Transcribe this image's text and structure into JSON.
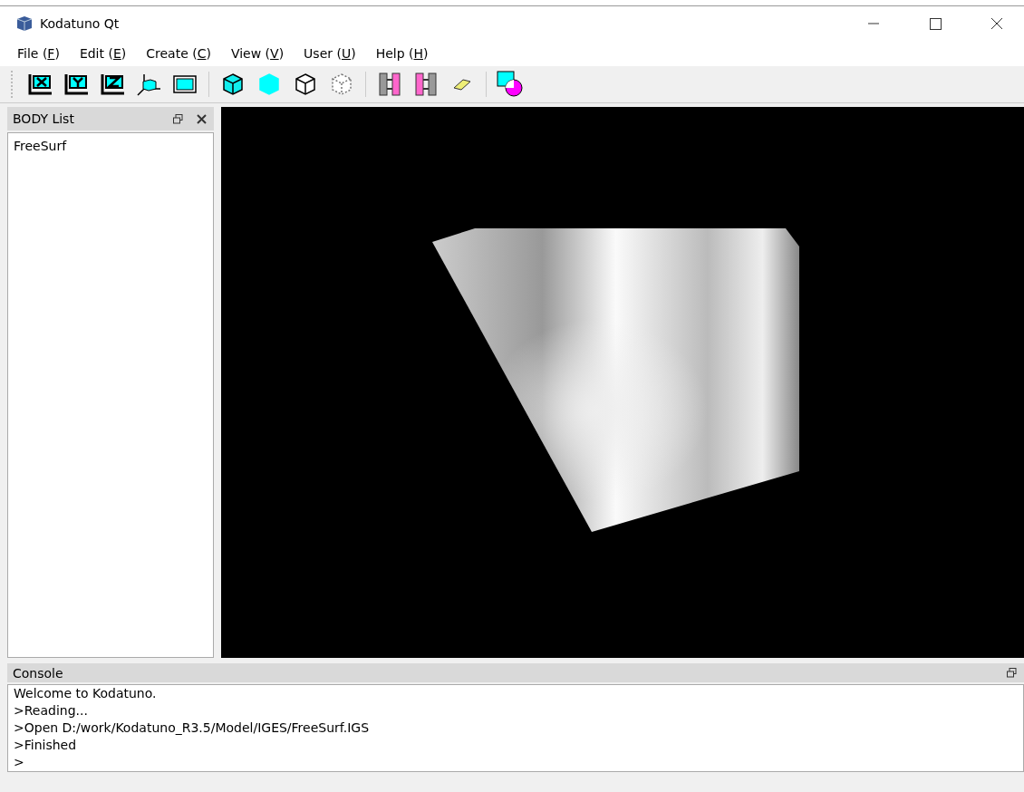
{
  "window": {
    "title": "Kodatuno Qt"
  },
  "menu": [
    {
      "before": "File (",
      "mnemonic": "F",
      "after": ")"
    },
    {
      "before": "Edit (",
      "mnemonic": "E",
      "after": ")"
    },
    {
      "before": "Create (",
      "mnemonic": "C",
      "after": ")"
    },
    {
      "before": "View (",
      "mnemonic": "V",
      "after": ")"
    },
    {
      "before": "User (",
      "mnemonic": "U",
      "after": ")"
    },
    {
      "before": "Help (",
      "mnemonic": "H",
      "after": ")"
    }
  ],
  "body_list": {
    "title": "BODY List",
    "items": [
      "FreeSurf"
    ]
  },
  "console": {
    "title": "Console",
    "lines": [
      "Welcome to Kodatuno.",
      ">Reading...",
      ">Open D:/work/Kodatuno_R3.5/Model/IGES/FreeSurf.IGS",
      ">Finished",
      ">"
    ]
  }
}
